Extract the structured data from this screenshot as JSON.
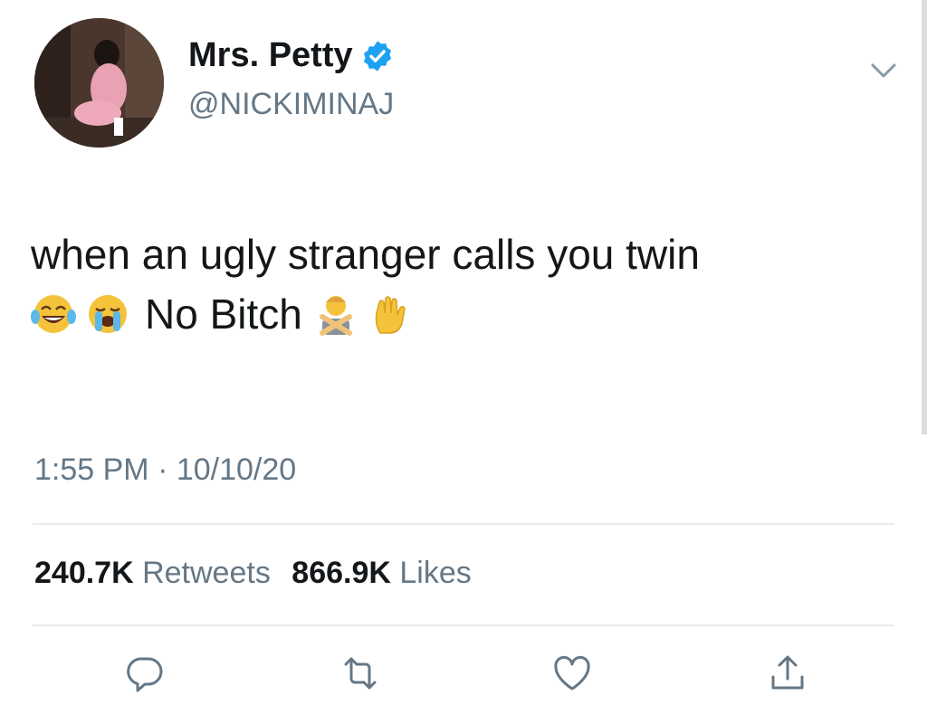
{
  "tweet": {
    "display_name": "Mrs. Petty",
    "handle": "@NICKIMINAJ",
    "verified": true,
    "text_line1": "when an ugly stranger calls you twin",
    "text_line2": "No Bitch",
    "emojis_before": [
      "face-with-tears-of-joy",
      "loudly-crying-face"
    ],
    "emojis_after": [
      "person-gesturing-no",
      "raised-hand"
    ],
    "time": "1:55 PM · 10/10/20",
    "retweets_count": "240.7K",
    "retweets_label": "Retweets",
    "likes_count": "866.9K",
    "likes_label": "Likes"
  },
  "icons": {
    "menu": "chevron-down-icon",
    "reply": "reply-icon",
    "retweet": "retweet-icon",
    "like": "heart-icon",
    "share": "share-icon"
  },
  "colors": {
    "verified_blue": "#1da1f2",
    "secondary_text": "#657786",
    "primary_text": "#14171a",
    "divider": "#e6ecf0"
  }
}
